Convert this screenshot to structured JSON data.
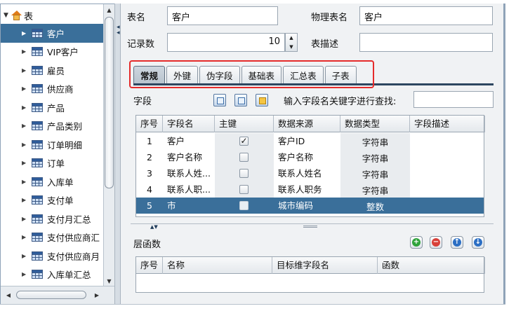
{
  "tree": {
    "root_label": "表",
    "selected_index": 0,
    "items": [
      {
        "label": "客户"
      },
      {
        "label": "VIP客户"
      },
      {
        "label": "雇员"
      },
      {
        "label": "供应商"
      },
      {
        "label": "产品"
      },
      {
        "label": "产品类别"
      },
      {
        "label": "订单明细"
      },
      {
        "label": "订单"
      },
      {
        "label": "入库单"
      },
      {
        "label": "支付单"
      },
      {
        "label": "支付月汇总"
      },
      {
        "label": "支付供应商汇"
      },
      {
        "label": "支付供应商月"
      },
      {
        "label": "入库单汇总"
      }
    ]
  },
  "form": {
    "table_name_label": "表名",
    "table_name_value": "客户",
    "physical_name_label": "物理表名",
    "physical_name_value": "客户",
    "record_count_label": "记录数",
    "record_count_value": "10",
    "table_desc_label": "表描述",
    "table_desc_value": ""
  },
  "tabs": [
    {
      "label": "常规",
      "active": true
    },
    {
      "label": "外键",
      "active": false
    },
    {
      "label": "伪字段",
      "active": false
    },
    {
      "label": "基础表",
      "active": false
    },
    {
      "label": "汇总表",
      "active": false
    },
    {
      "label": "子表",
      "active": false
    }
  ],
  "fields_section": {
    "label": "字段",
    "search_label": "输入字段名关键字进行查找:",
    "search_value": ""
  },
  "fields_grid": {
    "columns": [
      "序号",
      "字段名",
      "主键",
      "数据来源",
      "数据类型",
      "字段描述"
    ],
    "selected_index": 4,
    "rows": [
      {
        "no": "1",
        "name": "客户",
        "pk": true,
        "source": "客户ID",
        "type": "字符串",
        "desc": ""
      },
      {
        "no": "2",
        "name": "客户名称",
        "pk": false,
        "source": "客户名称",
        "type": "字符串",
        "desc": ""
      },
      {
        "no": "3",
        "name": "联系人姓...",
        "pk": false,
        "source": "联系人姓名",
        "type": "字符串",
        "desc": ""
      },
      {
        "no": "4",
        "name": "联系人职...",
        "pk": false,
        "source": "联系人职务",
        "type": "字符串",
        "desc": ""
      },
      {
        "no": "5",
        "name": "市",
        "pk": false,
        "source": "城市编码",
        "type": "整数",
        "desc": ""
      }
    ]
  },
  "hierarchy_section": {
    "label": "层函数",
    "columns": [
      "序号",
      "名称",
      "目标维字段名",
      "函数"
    ]
  },
  "colors": {
    "selection": "#3a6f9a",
    "highlight": "#e52b2b"
  }
}
